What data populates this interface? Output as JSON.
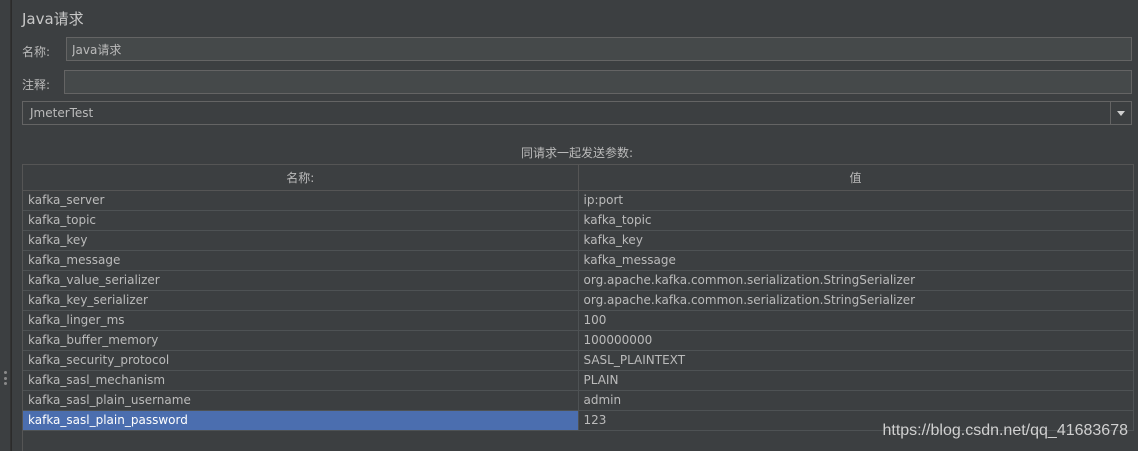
{
  "title": "Java请求",
  "name_field": {
    "label": "名称:",
    "value": "Java请求"
  },
  "comment_field": {
    "label": "注释:",
    "value": ""
  },
  "classname_select": {
    "value": "JmeterTest"
  },
  "params": {
    "caption": "同请求一起发送参数:",
    "columns": [
      "名称:",
      "值"
    ],
    "rows": [
      {
        "name": "kafka_server",
        "value": "ip:port"
      },
      {
        "name": "kafka_topic",
        "value": "kafka_topic"
      },
      {
        "name": "kafka_key",
        "value": "kafka_key"
      },
      {
        "name": "kafka_message",
        "value": "kafka_message"
      },
      {
        "name": "kafka_value_serializer",
        "value": "org.apache.kafka.common.serialization.StringSerializer"
      },
      {
        "name": "kafka_key_serializer",
        "value": "org.apache.kafka.common.serialization.StringSerializer"
      },
      {
        "name": "kafka_linger_ms",
        "value": "100"
      },
      {
        "name": "kafka_buffer_memory",
        "value": "100000000"
      },
      {
        "name": "kafka_security_protocol",
        "value": "SASL_PLAINTEXT"
      },
      {
        "name": "kafka_sasl_mechanism",
        "value": "PLAIN"
      },
      {
        "name": "kafka_sasl_plain_username",
        "value": "admin"
      },
      {
        "name": "kafka_sasl_plain_password",
        "value": "123",
        "selected": true
      }
    ]
  },
  "colors": {
    "background": "#3c3f41",
    "selection": "#4b6eaf",
    "border": "#646464"
  },
  "icons": {
    "dropdown": "chevron-down-icon",
    "splitter": "drag-handle-icon"
  },
  "watermark": "https://blog.csdn.net/qq_41683678"
}
